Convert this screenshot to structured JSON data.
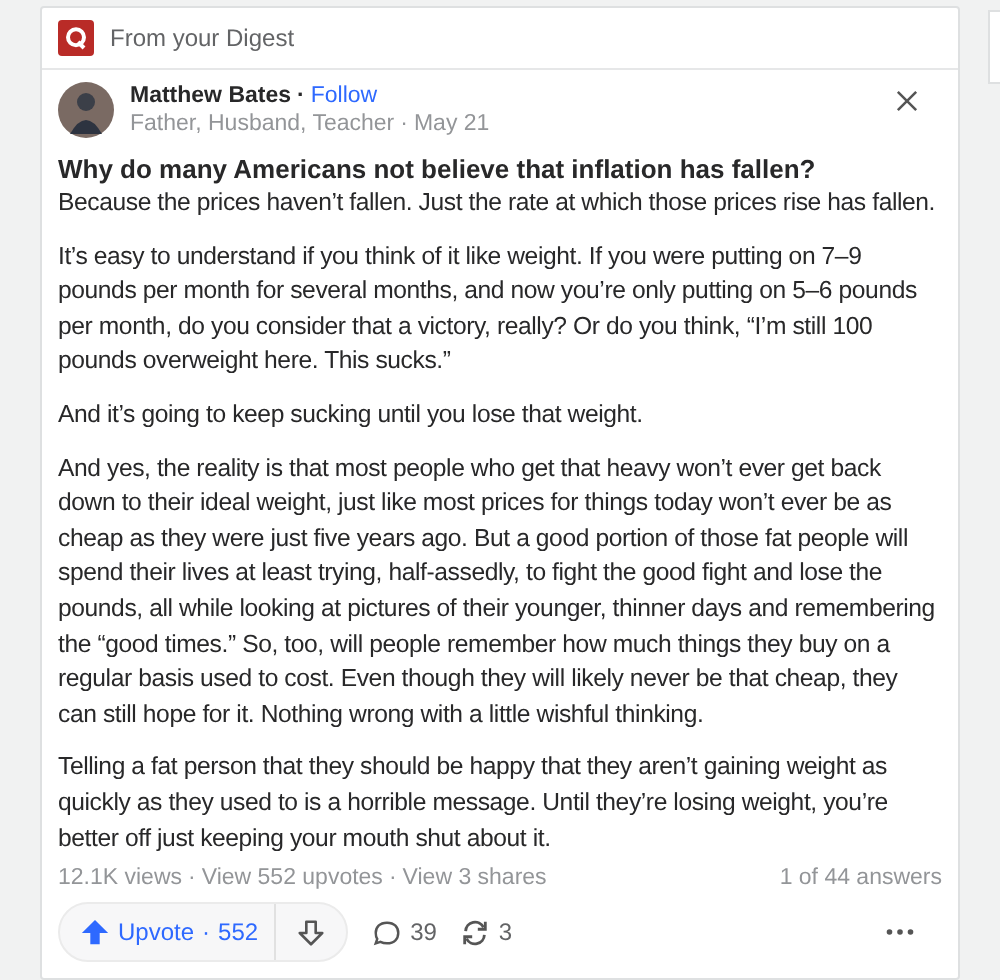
{
  "separator": "·",
  "digest": {
    "label": "From your Digest"
  },
  "author": {
    "name": "Matthew Bates",
    "follow": "Follow",
    "credentials": "Father, Husband, Teacher",
    "date": "May 21"
  },
  "question": "Why do many Americans not believe that inflation has fallen?",
  "paragraphs": [
    "Because the prices haven’t fallen. Just the rate at which those prices rise has fallen.",
    "It’s easy to understand if you think of it like weight. If you were putting on 7–9 pounds per month for several months, and now you’re only putting on 5–6 pounds per month, do you consider that a victory, really? Or do you think, “I’m still 100 pounds overweight here. This sucks.”",
    "And it’s going to keep sucking until you lose that weight.",
    "And yes, the reality is that most people who get that heavy won’t ever get back down to their ideal weight, just like most prices for things today won’t ever be as cheap as they were just five years ago. But a good portion of those fat people will spend their lives at least trying, half-assedly, to fight the good fight and lose the pounds, all while looking at pictures of their younger, thinner days and remembering the “good times.” So, too, will people remember how much things they buy on a regular basis used to cost. Even though they will likely never be that cheap, they can still hope for it. Nothing wrong with a little wishful thinking.",
    "Telling a fat person that they should be happy that they aren’t gaining weight as quickly as they used to is a horrible message. Until they’re losing weight, you’re better off just keeping your mouth shut about it."
  ],
  "stats": {
    "views": "12.1K views",
    "upvotes": "View 552 upvotes",
    "shares": "View 3 shares",
    "answer_position": "1 of 44 answers"
  },
  "actions": {
    "upvote": "Upvote",
    "upvote_count": "552",
    "comments": "39",
    "shares": "3"
  }
}
